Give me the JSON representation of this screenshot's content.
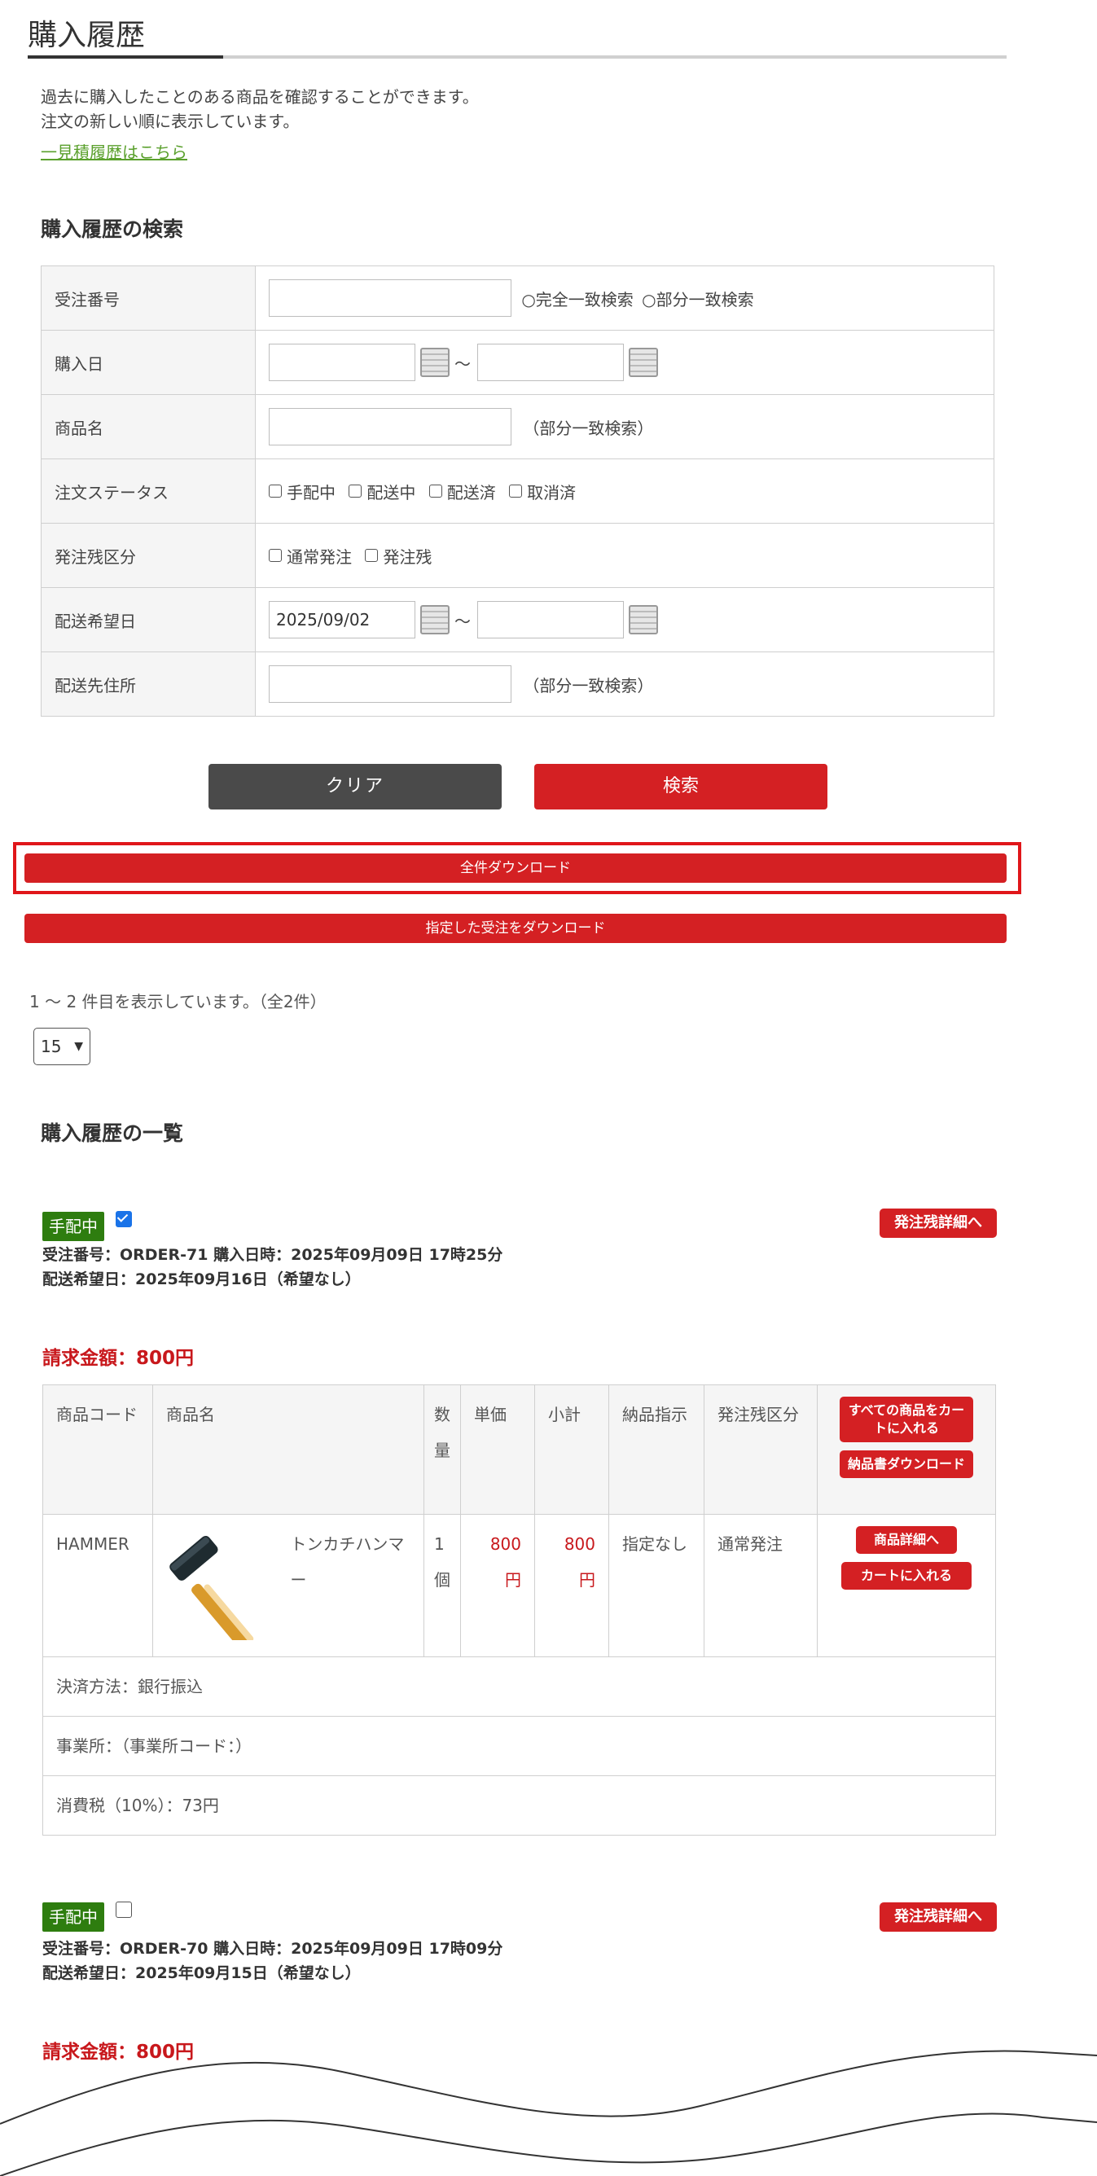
{
  "page": {
    "title": "購入履歴",
    "intro_line1": "過去に購入したことのある商品を確認することができます。",
    "intro_line2": "注文の新しい順に表示しています。",
    "summary_link": "一見積履歴はこちら"
  },
  "search": {
    "heading": "購入履歴の検索",
    "order_number_label": "受注番号",
    "exact_match": "○完全一致検索",
    "partial_match": "○部分一致検索",
    "purchase_date_label": "購入日",
    "tilde": "～",
    "product_name_label": "商品名",
    "partial_hint": "（部分一致検索）",
    "status_label": "注文ステータス",
    "status_options": [
      "手配中",
      "配送中",
      "配送済",
      "取消済"
    ],
    "backorder_label": "発注残区分",
    "backorder_options": [
      "通常発注",
      "発注残"
    ],
    "delivery_date_label": "配送希望日",
    "delivery_date_from": "2025/09/02",
    "address_label": "配送先住所",
    "address_hint": "（部分一致検索）",
    "clear_button": "クリア",
    "search_button": "検索"
  },
  "downloads": {
    "all": "全件ダウンロード",
    "selected": "指定した受注をダウンロード"
  },
  "listing": {
    "count_text": "1 ～ 2 件目を表示しています。（全2件）",
    "per_page": "15",
    "heading": "購入履歴の一覧"
  },
  "orders": [
    {
      "status": "手配中",
      "checked": true,
      "backorder_button": "発注残詳細へ",
      "meta_line1": "受注番号：ORDER-71 購入日時：2025年09月09日 17時25分",
      "meta_line2": "配送希望日：2025年09月16日（希望なし）",
      "amount": "請求金額：800円",
      "columns": {
        "code": "商品コード",
        "name": "商品名",
        "qty": "数量",
        "unit_price": "単価",
        "subtotal": "小計",
        "delivery": "納品指示",
        "backorder": "発注残区分"
      },
      "add_all_button": "すべての商品をカートに入れる",
      "invoice_button": "納品書ダウンロード",
      "item": {
        "code": "HAMMER",
        "name": "トンカチハンマー",
        "qty": "1個",
        "unit_price": "800円",
        "subtotal": "800円",
        "delivery": "指定なし",
        "backorder": "通常発注",
        "detail_button": "商品詳細へ",
        "cart_button": "カートに入れる"
      },
      "payment": "決済方法：銀行振込",
      "office": "事業所：（事業所コード：）",
      "tax": "消費税（10%）：73円"
    },
    {
      "status": "手配中",
      "checked": false,
      "backorder_button": "発注残詳細へ",
      "meta_line1": "受注番号：ORDER-70 購入日時：2025年09月09日 17時09分",
      "meta_line2": "配送希望日：2025年09月15日（希望なし）",
      "amount": "請求金額：800円"
    }
  ],
  "colors": {
    "accent_red": "#d42023",
    "status_green": "#2e7d0f",
    "price_red": "#c8181c",
    "link_green": "#5aa02c",
    "highlight_frame": "#e0161a"
  }
}
